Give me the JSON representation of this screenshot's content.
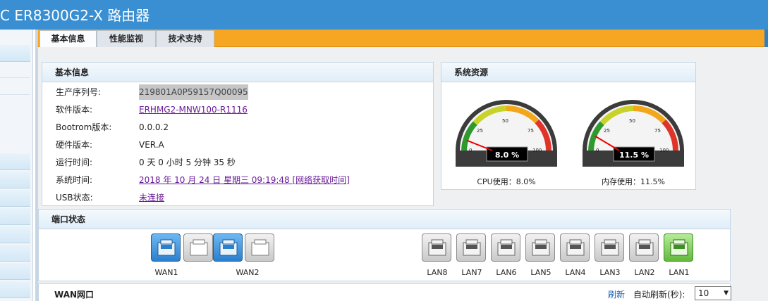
{
  "header": {
    "title": "C ER8300G2-X 路由器"
  },
  "tabs": [
    {
      "label": "基本信息",
      "active": true
    },
    {
      "label": "性能监视",
      "active": false
    },
    {
      "label": "技术支持",
      "active": false
    }
  ],
  "basic_info": {
    "title": "基本信息",
    "rows": [
      {
        "label": "生产序列号:",
        "value": "219801A0P59157Q00095"
      },
      {
        "label": "软件版本:",
        "value": "ERHMG2-MNW100-R1116"
      },
      {
        "label": "Bootrom版本:",
        "value": "0.0.0.2"
      },
      {
        "label": "硬件版本:",
        "value": "VER.A"
      },
      {
        "label": "运行时间:",
        "value": "0 天 0 小时 5 分钟 35 秒"
      },
      {
        "label": "系统时间:",
        "value": "2018 年 10 月 24 日 星期三 09:19:48  [网络获取时间]"
      },
      {
        "label": "USB状态:",
        "value": "未连接"
      }
    ]
  },
  "resources": {
    "title": "系统资源",
    "cpu": {
      "value": 8.0,
      "display": "8.0 %",
      "caption": "CPU使用：8.0%"
    },
    "mem": {
      "value": 11.5,
      "display": "11.5 %",
      "caption": "内存使用：11.5%"
    },
    "scale": {
      "min": "0",
      "t25": "25",
      "t50": "50",
      "t75": "75",
      "max": "100"
    }
  },
  "ports": {
    "title": "端口状态",
    "wan": [
      {
        "label": "WAN1",
        "state": "active"
      },
      {
        "label": "WAN2",
        "state": "active"
      }
    ],
    "lan": [
      {
        "label": "LAN8",
        "state": "down"
      },
      {
        "label": "LAN7",
        "state": "down"
      },
      {
        "label": "LAN6",
        "state": "down"
      },
      {
        "label": "LAN5",
        "state": "down"
      },
      {
        "label": "LAN4",
        "state": "down"
      },
      {
        "label": "LAN3",
        "state": "down"
      },
      {
        "label": "LAN2",
        "state": "down"
      },
      {
        "label": "LAN1",
        "state": "up"
      }
    ]
  },
  "wan_section": {
    "title": "WAN网口",
    "refresh": "刷新",
    "auto_refresh_label": "自动刷新(秒):",
    "auto_refresh_value": "10"
  },
  "colors": {
    "header": "#3a8fd2",
    "tabbar": "#f6a623",
    "link": "#6a1b9a",
    "port_active": "#2c7fcd",
    "port_up": "#62b93c"
  }
}
